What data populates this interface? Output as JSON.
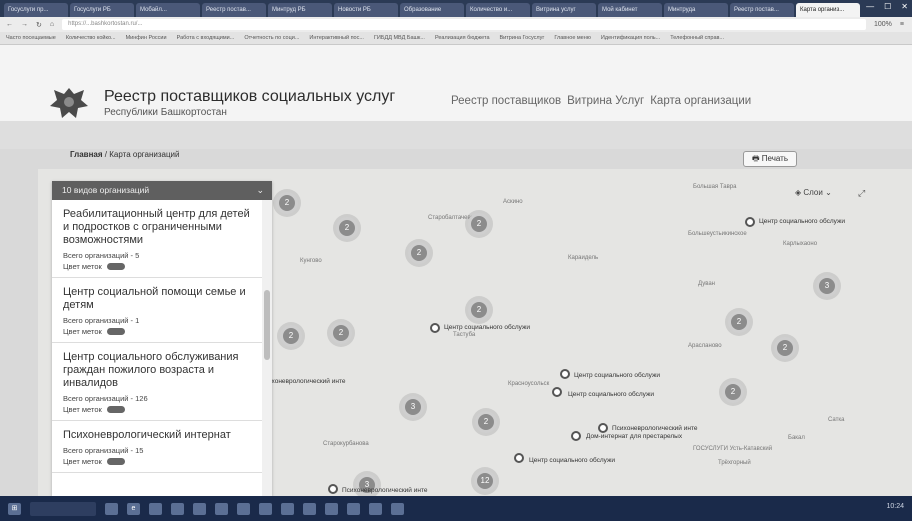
{
  "browser": {
    "tabs": [
      {
        "label": "Госуслуги пр..."
      },
      {
        "label": "Госуслуги РБ"
      },
      {
        "label": "Мобайл..."
      },
      {
        "label": "Реестр постав..."
      },
      {
        "label": "Минтруд РБ"
      },
      {
        "label": "Новости РБ"
      },
      {
        "label": "Образование"
      },
      {
        "label": "Количество и..."
      },
      {
        "label": "Витрина услуг"
      },
      {
        "label": "Мой кабинет"
      },
      {
        "label": "Минтруда"
      },
      {
        "label": "Реестр постав..."
      },
      {
        "label": "Карта организ..."
      }
    ],
    "url": "https://...bashkortostan.ru/...",
    "zoom": "100%",
    "bookmarks": [
      "Часто посещаемые",
      "Количество койко...",
      "Минфин России",
      "Работа с входящими...",
      "Отчетность по соци...",
      "Интерактивный пос...",
      "ГИБДД МВД Башк...",
      "Реализация бюджета",
      "Витрина Госуслуг",
      "Главное меню",
      "Идентификация поль...",
      "Телефонный справ..."
    ]
  },
  "site": {
    "title": "Реестр поставщиков социальных услуг",
    "subtitle": "Республики Башкортостан",
    "nav": [
      "Реестр поставщиков",
      "Витрина Услуг",
      "Карта организации"
    ]
  },
  "breadcrumb": {
    "home": "Главная",
    "sep": "/",
    "current": "Карта организаций"
  },
  "print_label": "Печать",
  "map": {
    "layers_label": "Слои",
    "place_labels": [
      "Аскино",
      "Большая Тавра",
      "Большеустьикинское",
      "Карлыхаоно",
      "Кунгово",
      "Караидель",
      "Дуван",
      "Арасланово",
      "Старобалтачево",
      "Сатка",
      "Бакал",
      "Тастуба",
      "Красноусольск",
      "Старокурбанова",
      "Трёхгорный",
      "ГОСУСЛУГИ Усть-Катавский"
    ],
    "clusters": [
      "2",
      "2",
      "2",
      "2",
      "2",
      "2",
      "2",
      "2",
      "3",
      "2",
      "3",
      "2",
      "2",
      "3",
      "12"
    ],
    "pins": [
      "Центр социального обслужи",
      "Центр социального обслужи",
      "Центр социального обслужи",
      "Центр социального обслужи",
      "Психоневрологический инте",
      "Дом-интернат для престарелых",
      "Центр социального обслужи",
      "Психоневрологический инте",
      "Психоневрологический инте"
    ]
  },
  "panel": {
    "header": "10 видов организаций",
    "items": [
      {
        "name": "Реабилитационный центр для детей и подростков с ограниченными возможностями",
        "count": "Всего организаций - 5",
        "color_label": "Цвет меток"
      },
      {
        "name": "Центр социальной помощи семье и детям",
        "count": "Всего организаций - 1",
        "color_label": "Цвет меток"
      },
      {
        "name": "Центр социального обслуживания граждан пожилого возраста и инвалидов",
        "count": "Всего организаций - 126",
        "color_label": "Цвет меток"
      },
      {
        "name": "Психоневрологический интернат",
        "count": "Всего организаций - 15",
        "color_label": "Цвет меток"
      }
    ]
  },
  "taskbar": {
    "clock": "10:24"
  }
}
